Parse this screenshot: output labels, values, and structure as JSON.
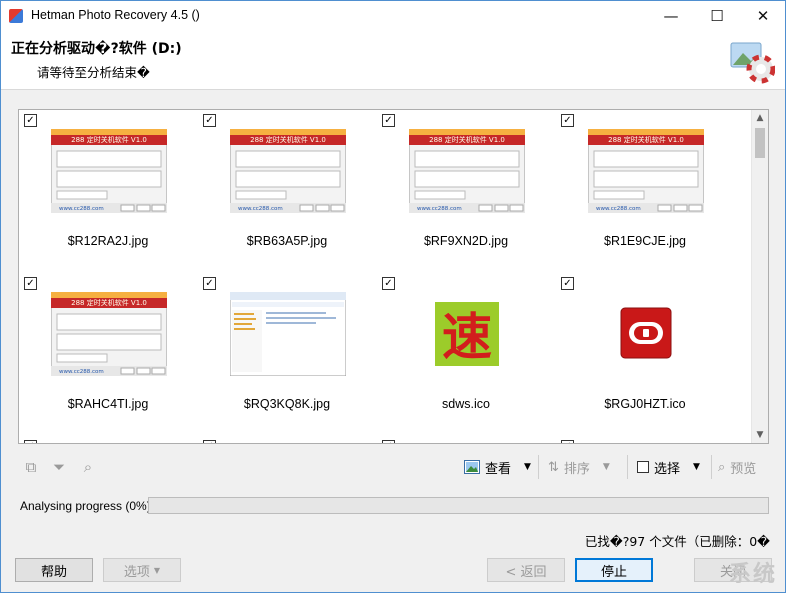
{
  "window": {
    "title": "Hetman Photo Recovery 4.5 ()",
    "controls": {
      "minimize": "—",
      "maximize": "☐",
      "close": "✕"
    }
  },
  "header": {
    "title": "正在分析驱动�?软件 (D:)",
    "subtitle": "请等待至分析结束�"
  },
  "files": [
    {
      "name": "$R12RA2J.jpg",
      "checked": true,
      "kind": "app-screenshot"
    },
    {
      "name": "$RB63A5P.jpg",
      "checked": true,
      "kind": "app-screenshot"
    },
    {
      "name": "$RF9XN2D.jpg",
      "checked": true,
      "kind": "app-screenshot"
    },
    {
      "name": "$R1E9CJE.jpg",
      "checked": true,
      "kind": "app-screenshot"
    },
    {
      "name": "$RAHC4TI.jpg",
      "checked": true,
      "kind": "app-screenshot"
    },
    {
      "name": "$RQ3KQ8K.jpg",
      "checked": true,
      "kind": "explorer-screenshot"
    },
    {
      "name": "sdws.ico",
      "checked": true,
      "kind": "speed-icon"
    },
    {
      "name": "$RGJ0HZT.ico",
      "checked": true,
      "kind": "power-icon"
    }
  ],
  "thumb_screens": {
    "app_banner": "288 定时关机软件 V1.0",
    "app_footer": "www.cc288.com",
    "speed_char": "速"
  },
  "toolbar": {
    "view_label": "查看",
    "sort_label": "排序",
    "select_label": "选择",
    "preview_label": "预览"
  },
  "progress": {
    "label": "Analysing progress (0%)",
    "value": 0
  },
  "status": {
    "found_text": "已找�?97 个文件（已删除：0�"
  },
  "buttons": {
    "help": "帮助",
    "options": "选项",
    "back": "< 返回",
    "stop": "停止",
    "close": "关闭"
  },
  "watermark": "系统",
  "colors": {
    "accent": "#0078d7",
    "progress_fill": "#06b025",
    "dialog_red": "#c0392b"
  }
}
